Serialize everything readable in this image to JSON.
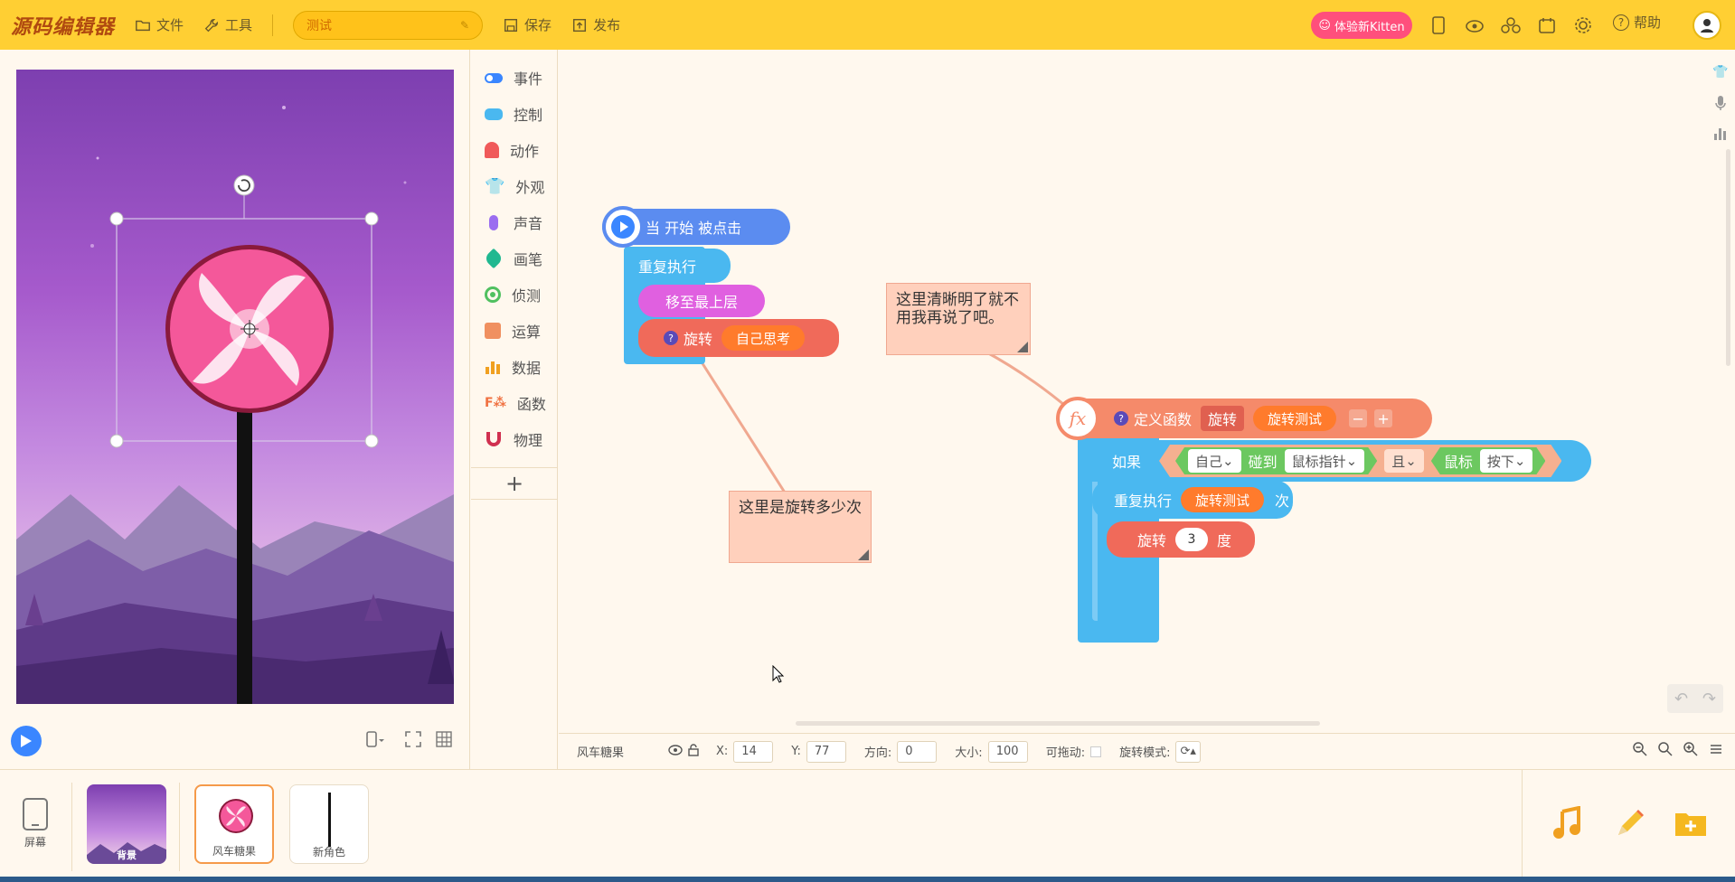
{
  "header": {
    "logo": "源码编辑器",
    "menu_file": "文件",
    "menu_tools": "工具",
    "project_name": "测试",
    "save": "保存",
    "publish": "发布",
    "kitten_btn": "体验新Kitten",
    "help": "帮助"
  },
  "categories": [
    {
      "label": "事件",
      "color": "#3a86ff",
      "icon": "toggle-icon"
    },
    {
      "label": "控制",
      "color": "#4ab8f0",
      "icon": "gamepad-icon"
    },
    {
      "label": "动作",
      "color": "#f05a5a",
      "icon": "ghost-icon"
    },
    {
      "label": "外观",
      "color": "#e060e0",
      "icon": "shirt-icon"
    },
    {
      "label": "声音",
      "color": "#9b6df0",
      "icon": "mic-icon"
    },
    {
      "label": "画笔",
      "color": "#20b890",
      "icon": "pen-icon"
    },
    {
      "label": "侦测",
      "color": "#50c060",
      "icon": "radar-icon"
    },
    {
      "label": "运算",
      "color": "#f09060",
      "icon": "calculator-icon"
    },
    {
      "label": "数据",
      "color": "#f0a020",
      "icon": "bars-icon"
    },
    {
      "label": "函数",
      "color": "#f07040",
      "icon": "function-icon"
    },
    {
      "label": "物理",
      "color": "#d03050",
      "icon": "magnet-icon"
    }
  ],
  "blocks": {
    "when_start": "当 开始 被点击",
    "repeat_forever": "重复执行",
    "move_to_top": "移至最上层",
    "rotate": "旋转",
    "rotate_param": "自己思考",
    "define_fn": "定义函数",
    "fn_name": "旋转",
    "fn_param": "旋转测试",
    "if": "如果",
    "self": "自己",
    "touch": "碰到",
    "mouse_pointer": "鼠标指针",
    "and": "且",
    "mouse": "鼠标",
    "pressed": "按下",
    "repeat": "重复执行",
    "repeat_var": "旋转测试",
    "times": "次",
    "rotate2": "旋转",
    "degree_val": "3",
    "degree": "度"
  },
  "notes": {
    "note1": "这里清晰明了就不用我再说了吧。",
    "note2": "这里是旋转多少次"
  },
  "props": {
    "sprite_name": "风车糖果",
    "x_label": "X:",
    "x": "14",
    "y_label": "Y:",
    "y": "77",
    "dir_label": "方向:",
    "dir": "0",
    "size_label": "大小:",
    "size": "100",
    "drag_label": "可拖动:",
    "rot_label": "旋转模式:"
  },
  "bottom": {
    "screen": "屏幕",
    "bg_label": "背景",
    "sprite1": "风车糖果",
    "sprite2": "新角色"
  },
  "colors": {
    "accent": "#ffcf33",
    "control": "#4ab8f0",
    "looks": "#e060e0",
    "motion": "#f06a5a",
    "function": "#f58a6a",
    "sensing": "#6cc860"
  }
}
